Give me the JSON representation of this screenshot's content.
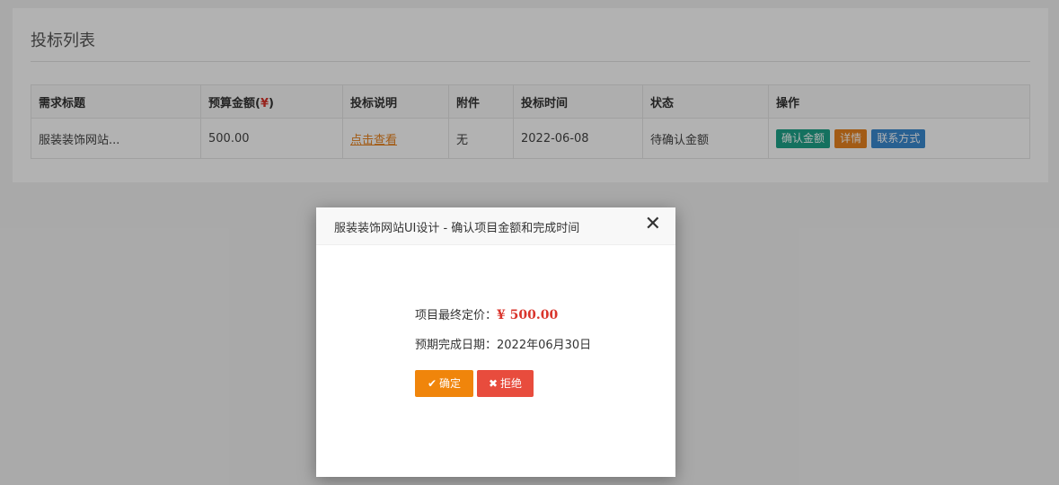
{
  "panel": {
    "title": "投标列表"
  },
  "table": {
    "headers": {
      "title": "需求标题",
      "budget_prefix": "预算金额(",
      "budget_symbol": "¥",
      "budget_suffix": ")",
      "description": "投标说明",
      "attachment": "附件",
      "time": "投标时间",
      "status": "状态",
      "actions": "操作"
    },
    "rows": [
      {
        "title": "服装装饰网站...",
        "budget": "500.00",
        "description_link": "点击查看",
        "attachment": "无",
        "time": "2022-06-08",
        "status": "待确认金额",
        "actions": [
          "确认金额",
          "详情",
          "联系方式"
        ]
      }
    ]
  },
  "modal": {
    "title": "服装装饰网站UI设计 - 确认项目金额和完成时间",
    "close_symbol": "✕",
    "price_label": "项目最终定价：",
    "price_value": "¥ 500.00",
    "date_label": "预期完成日期：",
    "date_value": "2022年06月30日",
    "confirm_label": "确定",
    "confirm_icon": "✔",
    "reject_label": "拒绝",
    "reject_icon": "✖"
  },
  "colors": {
    "accent_orange": "#e8831f",
    "danger_red": "#d9342b",
    "tag_green": "#1ea388",
    "tag_blue": "#3a8ad0"
  }
}
